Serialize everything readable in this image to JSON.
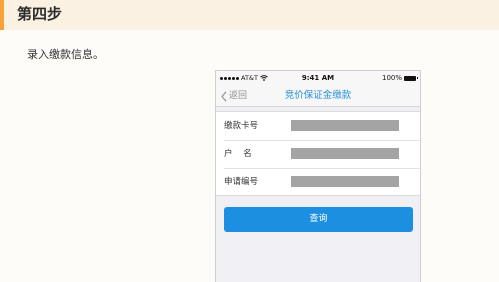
{
  "step": {
    "title": "第四步"
  },
  "instruction": "录入缴款信息。",
  "phone": {
    "status_bar": {
      "carrier": "AT&T",
      "time": "9:41 AM",
      "battery": "100%"
    },
    "nav": {
      "back_label": "返回",
      "title": "竞价保证金缴款"
    },
    "form": {
      "fields": [
        {
          "label": "缴款卡号",
          "value": ""
        },
        {
          "label": "户    名",
          "value": ""
        },
        {
          "label": "申请编号",
          "value": ""
        }
      ]
    },
    "query_button": "查询"
  },
  "colors": {
    "accent_bar": "#f7a13a",
    "header_bg": "#fbf1e2",
    "nav_title": "#2a90d9",
    "button": "#1d8fe0"
  }
}
